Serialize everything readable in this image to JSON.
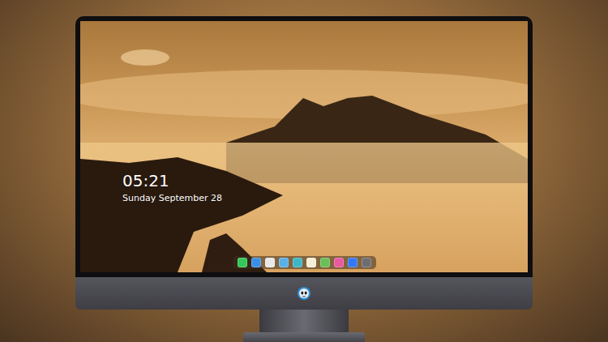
{
  "clock": {
    "time": "05:21",
    "date": "Sunday September 28"
  },
  "dock": {
    "items": [
      {
        "color": "#34c759"
      },
      {
        "color": "#3a8ee6"
      },
      {
        "color": "#e8e8e8"
      },
      {
        "color": "#5ab0e8"
      },
      {
        "color": "#3fb6c8"
      },
      {
        "color": "#f5efd6"
      },
      {
        "color": "#6bbf59"
      },
      {
        "color": "#e85aa0"
      },
      {
        "color": "#3478f6"
      },
      {
        "color": "#6d6d72"
      }
    ]
  }
}
